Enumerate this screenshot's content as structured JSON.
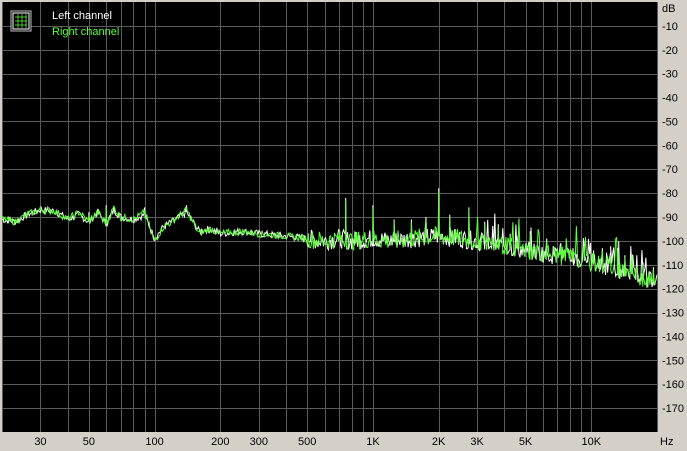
{
  "colors": {
    "background": "#000000",
    "grid": "#5a5a5a",
    "left_channel": "#ffffff",
    "right_channel": "#5cff3a",
    "axis_panel": "#d4d0c8"
  },
  "legend": {
    "icon": "chart-toggle-icon",
    "items": [
      {
        "label": "Left channel",
        "color": "#ffffff"
      },
      {
        "label": "Right channel",
        "color": "#5cff3a"
      }
    ]
  },
  "chart_data": {
    "type": "line",
    "x_scale": "log",
    "xlabel": "Hz",
    "ylabel": "dB",
    "xlim": [
      20,
      20000
    ],
    "ylim": [
      -180,
      0
    ],
    "grid": true,
    "legend_position": "top-left",
    "x_ticks": [
      {
        "value": 30,
        "label": "30"
      },
      {
        "value": 50,
        "label": "50"
      },
      {
        "value": 100,
        "label": "100"
      },
      {
        "value": 200,
        "label": "200"
      },
      {
        "value": 300,
        "label": "300"
      },
      {
        "value": 500,
        "label": "500"
      },
      {
        "value": 1000,
        "label": "1K"
      },
      {
        "value": 2000,
        "label": "2K"
      },
      {
        "value": 3000,
        "label": "3K"
      },
      {
        "value": 5000,
        "label": "5K"
      },
      {
        "value": 10000,
        "label": "10K"
      }
    ],
    "y_ticks": [
      -10,
      -20,
      -30,
      -40,
      -50,
      -60,
      -70,
      -80,
      -90,
      -100,
      -110,
      -120,
      -130,
      -140,
      -150,
      -160,
      -170
    ],
    "series": [
      {
        "name": "Left channel",
        "color": "#ffffff",
        "x": [
          20,
          23,
          26,
          30,
          35,
          40,
          45,
          50,
          55,
          60,
          65,
          70,
          80,
          90,
          100,
          110,
          120,
          140,
          160,
          180,
          200,
          250,
          300,
          400,
          500,
          600,
          700,
          800,
          1000,
          1200,
          1500,
          2000,
          2500,
          3000,
          4000,
          5000,
          7000,
          10000,
          15000,
          20000
        ],
        "y": [
          -91,
          -92,
          -89,
          -87,
          -87.5,
          -91,
          -89,
          -92,
          -88,
          -93,
          -87,
          -90,
          -91,
          -89,
          -99,
          -94,
          -92,
          -88,
          -96,
          -95,
          -97,
          -96,
          -97,
          -98,
          -99,
          -100,
          -99,
          -100,
          -99,
          -100,
          -99,
          -98,
          -99,
          -100,
          -102,
          -104,
          -106,
          -109,
          -113,
          -118
        ]
      },
      {
        "name": "Right channel",
        "color": "#5cff3a",
        "x": [
          20,
          23,
          26,
          30,
          35,
          40,
          45,
          50,
          55,
          60,
          65,
          70,
          80,
          90,
          100,
          110,
          120,
          140,
          160,
          180,
          200,
          250,
          300,
          400,
          500,
          600,
          700,
          800,
          1000,
          1200,
          1500,
          2000,
          2500,
          3000,
          4000,
          5000,
          7000,
          10000,
          15000,
          20000
        ],
        "y": [
          -91,
          -92,
          -89,
          -87,
          -87.5,
          -91,
          -88,
          -92,
          -88,
          -93,
          -86,
          -90,
          -91,
          -88,
          -100,
          -94,
          -92,
          -87,
          -97,
          -95,
          -97,
          -96,
          -97,
          -98,
          -99,
          -100,
          -99,
          -100,
          -99,
          -100,
          -99,
          -98,
          -99,
          -100,
          -102,
          -104,
          -106,
          -109,
          -113,
          -118
        ]
      }
    ],
    "peaks": [
      {
        "x": 50,
        "y": -89
      },
      {
        "x": 60,
        "y": -86
      },
      {
        "x": 90,
        "y": -87
      },
      {
        "x": 140,
        "y": -86
      },
      {
        "x": 750,
        "y": -83
      },
      {
        "x": 1000,
        "y": -86
      },
      {
        "x": 1250,
        "y": -92
      },
      {
        "x": 1500,
        "y": -92
      },
      {
        "x": 1750,
        "y": -91
      },
      {
        "x": 2000,
        "y": -79
      },
      {
        "x": 2250,
        "y": -90
      },
      {
        "x": 2750,
        "y": -87
      },
      {
        "x": 3250,
        "y": -93
      },
      {
        "x": 3750,
        "y": -94
      },
      {
        "x": 4250,
        "y": -98
      },
      {
        "x": 5250,
        "y": -97
      },
      {
        "x": 6250,
        "y": -100
      },
      {
        "x": 7250,
        "y": -102
      },
      {
        "x": 8250,
        "y": -104
      },
      {
        "x": 9250,
        "y": -102
      },
      {
        "x": 10250,
        "y": -105
      },
      {
        "x": 11250,
        "y": -104
      },
      {
        "x": 12250,
        "y": -106
      },
      {
        "x": 13250,
        "y": -104
      },
      {
        "x": 14250,
        "y": -107
      },
      {
        "x": 15250,
        "y": -108
      },
      {
        "x": 17250,
        "y": -110
      },
      {
        "x": 19250,
        "y": -112
      }
    ]
  }
}
